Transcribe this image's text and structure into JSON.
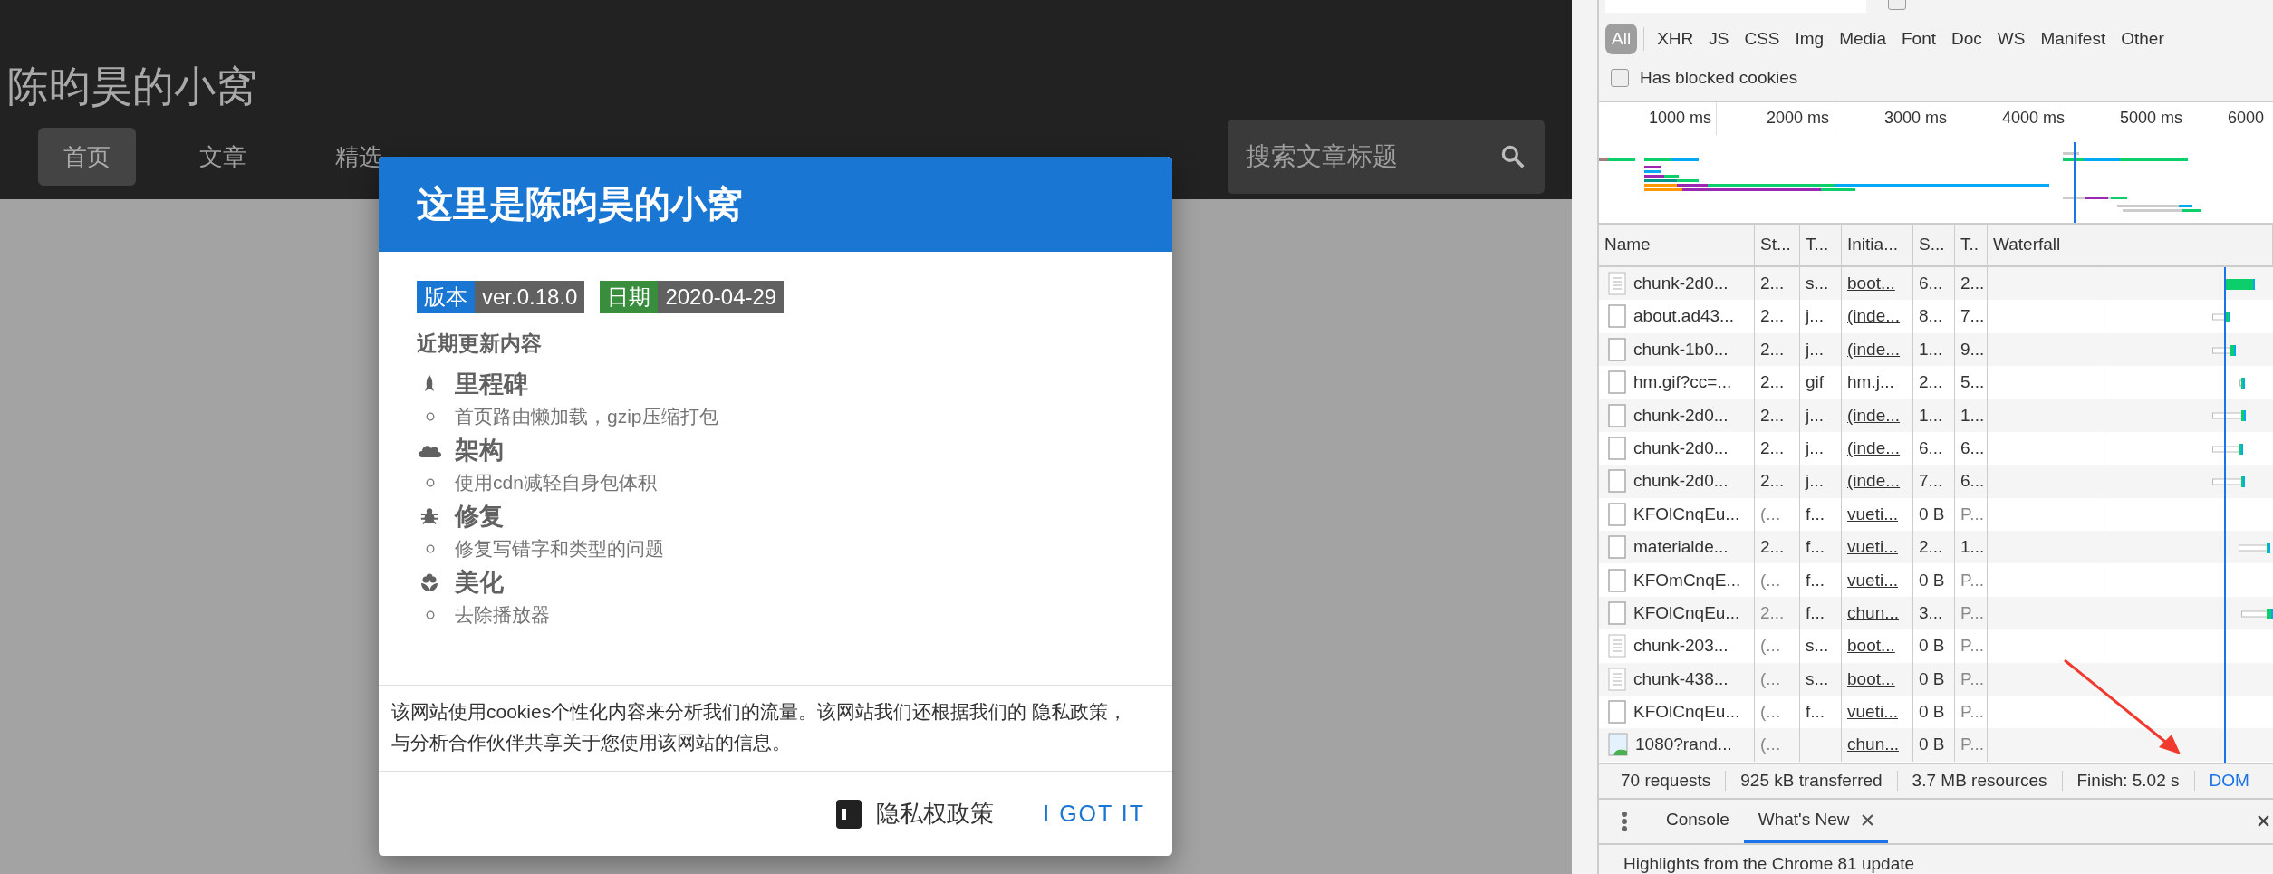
{
  "site": {
    "title": "陈昀昊的小窝",
    "nav": [
      {
        "label": "首页",
        "selected": true
      },
      {
        "label": "文章",
        "selected": false
      },
      {
        "label": "精选",
        "selected": false
      }
    ],
    "search": {
      "placeholder": "搜索文章标题"
    }
  },
  "dialog": {
    "title": "这里是陈昀昊的小窝",
    "badges": [
      {
        "label": "版本",
        "value": "ver.0.18.0",
        "color": "#1976d2"
      },
      {
        "label": "日期",
        "value": "2020-04-29",
        "color": "#388e3c"
      }
    ],
    "section_heading": "近期更新内容",
    "sections": [
      {
        "kind": "rocket",
        "title": "里程碑",
        "items": [
          "首页路由懒加载，gzip压缩打包"
        ]
      },
      {
        "kind": "cloud",
        "title": "架构",
        "items": [
          "使用cdn减轻自身包体积"
        ]
      },
      {
        "kind": "bug",
        "title": "修复",
        "items": [
          "修复写错字和类型的问题"
        ]
      },
      {
        "kind": "flower",
        "title": "美化",
        "items": [
          "去除播放器"
        ]
      }
    ],
    "cookie_notice": "该网站使用cookies个性化内容来分析我们的流量。该网站我们还根据我们的 隐私政策，与分析合作伙伴共享关于您使用该网站的信息。",
    "buttons": [
      {
        "kind": "policy",
        "label": "隐私权政策"
      },
      {
        "kind": "accept",
        "label": "I GOT IT"
      }
    ]
  },
  "devtools": {
    "hide_data_urls": {
      "checked": false
    },
    "types": [
      {
        "label": "All",
        "selected": true
      },
      {
        "label": "XHR",
        "selected": false
      },
      {
        "label": "JS",
        "selected": false
      },
      {
        "label": "CSS",
        "selected": false
      },
      {
        "label": "Img",
        "selected": false
      },
      {
        "label": "Media",
        "selected": false
      },
      {
        "label": "Font",
        "selected": false
      },
      {
        "label": "Doc",
        "selected": false
      },
      {
        "label": "WS",
        "selected": false
      },
      {
        "label": "Manifest",
        "selected": false
      },
      {
        "label": "Other",
        "selected": false
      }
    ],
    "blocked_cookies": {
      "label": "Has blocked cookies",
      "checked": false
    },
    "overview_ticks": [
      "1000 ms",
      "2000 ms",
      "3000 ms",
      "4000 ms",
      "5000 ms",
      "6000"
    ],
    "columns": [
      "Name",
      "St...",
      "T...",
      "Initia...",
      "S...",
      "T..",
      "Waterfall"
    ],
    "rows": [
      {
        "kind": "script",
        "name": "chunk-2d0...",
        "status": "2...",
        "type": "s...",
        "initiator": "boot...",
        "size": "6...",
        "time": "2...",
        "pending": false
      },
      {
        "kind": "doc",
        "name": "about.ad43...",
        "status": "2...",
        "type": "j...",
        "initiator": "(inde...",
        "size": "8...",
        "time": "7...",
        "pending": false
      },
      {
        "kind": "doc",
        "name": "chunk-1b0...",
        "status": "2...",
        "type": "j...",
        "initiator": "(inde...",
        "size": "1...",
        "time": "9...",
        "pending": false
      },
      {
        "kind": "doc",
        "name": "hm.gif?cc=...",
        "status": "2...",
        "type": "gif",
        "initiator": "hm.j...",
        "size": "2...",
        "time": "5...",
        "pending": false
      },
      {
        "kind": "doc",
        "name": "chunk-2d0...",
        "status": "2...",
        "type": "j...",
        "initiator": "(inde...",
        "size": "1...",
        "time": "1...",
        "pending": false
      },
      {
        "kind": "doc",
        "name": "chunk-2d0...",
        "status": "2...",
        "type": "j...",
        "initiator": "(inde...",
        "size": "6...",
        "time": "6...",
        "pending": false
      },
      {
        "kind": "doc",
        "name": "chunk-2d0...",
        "status": "2...",
        "type": "j...",
        "initiator": "(inde...",
        "size": "7...",
        "time": "6...",
        "pending": false
      },
      {
        "kind": "doc",
        "name": "KFOlCnqEu...",
        "status": "(...",
        "type": "f...",
        "initiator": "vueti...",
        "size": "0 B",
        "time": "P...",
        "pending": true
      },
      {
        "kind": "doc",
        "name": "materialde...",
        "status": "2...",
        "type": "f...",
        "initiator": "vueti...",
        "size": "2...",
        "time": "1...",
        "pending": false
      },
      {
        "kind": "doc",
        "name": "KFOmCnqE...",
        "status": "(...",
        "type": "f...",
        "initiator": "vueti...",
        "size": "0 B",
        "time": "P...",
        "pending": true
      },
      {
        "kind": "doc",
        "name": "KFOlCnqEu...",
        "status": "2...",
        "type": "f...",
        "initiator": "chun...",
        "size": "3...",
        "time": "P...",
        "pending": true
      },
      {
        "kind": "script",
        "name": "chunk-203...",
        "status": "(...",
        "type": "s...",
        "initiator": "boot...",
        "size": "0 B",
        "time": "P...",
        "pending": true
      },
      {
        "kind": "script",
        "name": "chunk-438...",
        "status": "(...",
        "type": "s...",
        "initiator": "boot...",
        "size": "0 B",
        "time": "P...",
        "pending": true
      },
      {
        "kind": "doc",
        "name": "KFOlCnqEu...",
        "status": "(...",
        "type": "f...",
        "initiator": "vueti...",
        "size": "0 B",
        "time": "P...",
        "pending": true
      },
      {
        "kind": "image",
        "name": "1080?rand...",
        "status": "(...",
        "initiator": "chun...",
        "size": "0 B",
        "time": "P...",
        "pending": true
      }
    ],
    "summary": [
      "70 requests",
      "925 kB transferred",
      "3.7 MB resources",
      "Finish: 5.02 s",
      "DOM"
    ],
    "drawer_tabs": [
      {
        "label": "Console",
        "selected": false,
        "closable": false
      },
      {
        "label": "What's New",
        "selected": true,
        "closable": true
      }
    ],
    "drawer_text": "Highlights from the Chrome 81 update"
  }
}
